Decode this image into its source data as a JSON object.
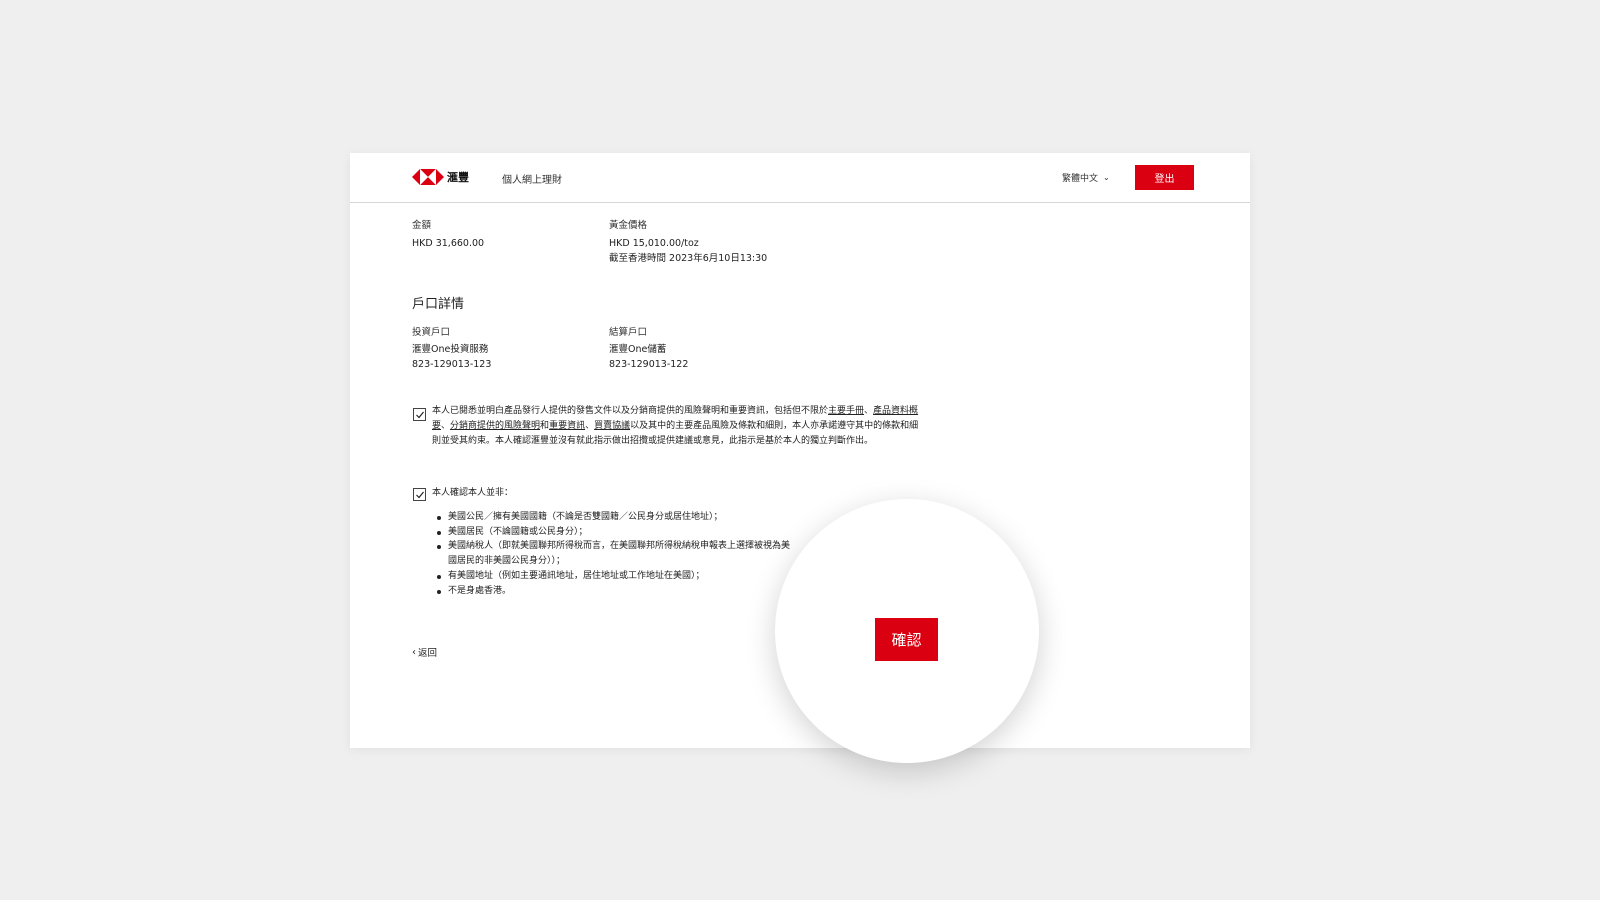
{
  "header": {
    "brand": "滙豐",
    "nav_title": "個人網上理財",
    "language": "繁體中文",
    "logout_label": "登出"
  },
  "summary": {
    "amount_label": "金額",
    "amount_value": "HKD 31,660.00",
    "price_label": "黃金價格",
    "price_value": "HKD 15,010.00/toz",
    "price_time": "截至香港時間 2023年6月10日13:30"
  },
  "account": {
    "title": "戶口詳情",
    "investment_label": "投資戶口",
    "investment_name": "滙豐One投資服務",
    "investment_number": "823-129013-123",
    "settlement_label": "結算戶口",
    "settlement_name": "滙豐One儲蓄",
    "settlement_number": "823-129013-122"
  },
  "declaration1": {
    "checked": true,
    "text_1": "本人已閱悉並明白產品發行人提供的發售文件以及分銷商提供的風險聲明和重要資訊，包括但不限於",
    "link_1": "主要手冊",
    "sep_1": "、",
    "link_2": "產品資料概要",
    "sep_2": "、",
    "link_3": "分銷商提供的風險聲明",
    "sep_3": "和",
    "link_4": "重要資訊",
    "sep_4": "、",
    "link_5": "買賣協議",
    "text_2": "以及其中的主要產品風險及條款和細則，本人亦承諾遵守其中的條款和細則並受其約束。本人確認滙豐並沒有就此指示做出招攬或提供建議或意見，此指示是基於本人的獨立判斷作出。"
  },
  "declaration2": {
    "checked": true,
    "heading": "本人確認本人並非：",
    "items": [
      "美國公民／擁有美國國籍（不論是否雙國籍／公民身分或居住地址）；",
      "美國居民（不論國籍或公民身分）；",
      "美國納稅人（即就美國聯邦所得稅而言，在美國聯邦所得稅納稅申報表上選擇被視為美國居民的非美國公民身分））；",
      "有美國地址（例如主要通訊地址，居住地址或工作地址在美國）；",
      "不是身處香港。"
    ]
  },
  "footer": {
    "back_label": "返回",
    "confirm_label": "確認"
  },
  "colors": {
    "brand_red": "#db0011",
    "background": "#efefef"
  }
}
